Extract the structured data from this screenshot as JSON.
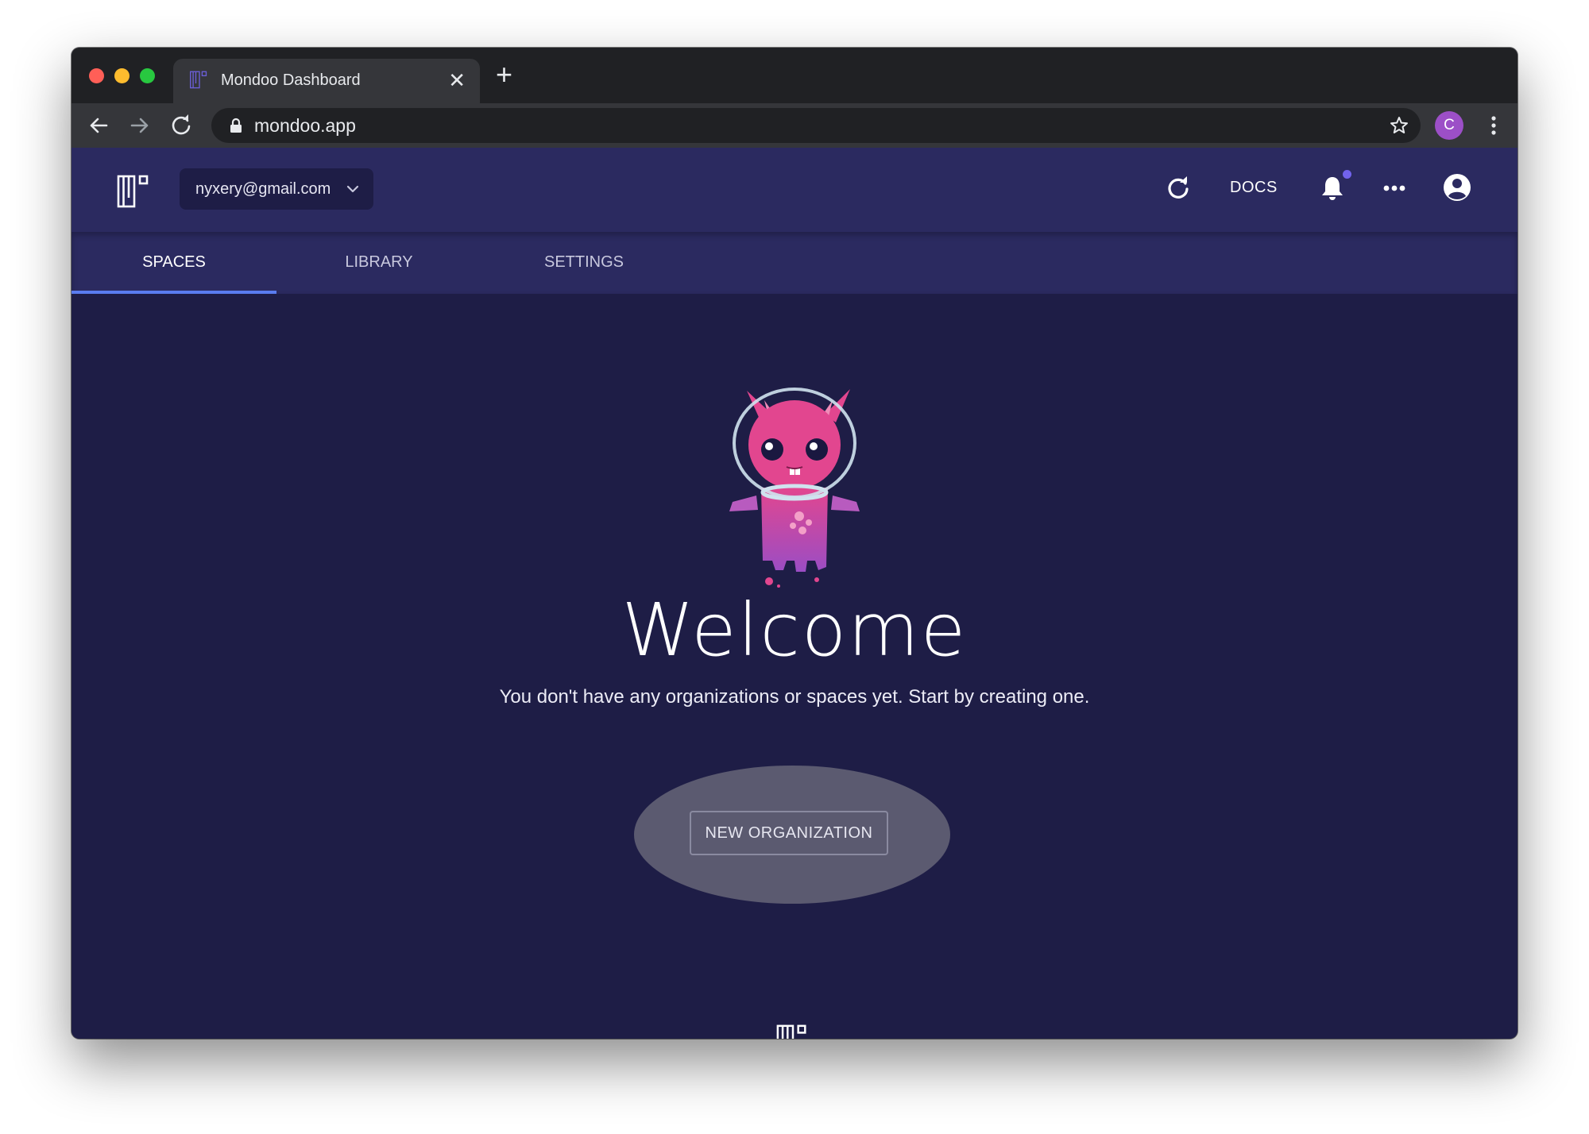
{
  "browser": {
    "tab_title": "Mondoo Dashboard",
    "close_glyph": "✕",
    "new_tab_glyph": "+",
    "url": "mondoo.app",
    "profile_initial": "C"
  },
  "header": {
    "account_email": "nyxery@gmail.com",
    "docs_label": "DOCS",
    "icons": [
      "logo",
      "chevron-down-icon",
      "refresh-icon",
      "bell-icon",
      "more-icon",
      "account-icon"
    ]
  },
  "nav": {
    "tabs": [
      {
        "label": "SPACES",
        "active": true
      },
      {
        "label": "LIBRARY",
        "active": false
      },
      {
        "label": "SETTINGS",
        "active": false
      }
    ]
  },
  "main": {
    "title": "Welcome",
    "subtitle": "You don't have any organizations or spaces yet. Start by creating one.",
    "cta_label": "NEW ORGANIZATION"
  },
  "colors": {
    "header_bg": "#2b2a60",
    "page_bg": "#1e1d46",
    "tab_underline": "#5a7cf0",
    "notification_dot": "#7263ee",
    "mascot_pink": "#e2468f"
  }
}
